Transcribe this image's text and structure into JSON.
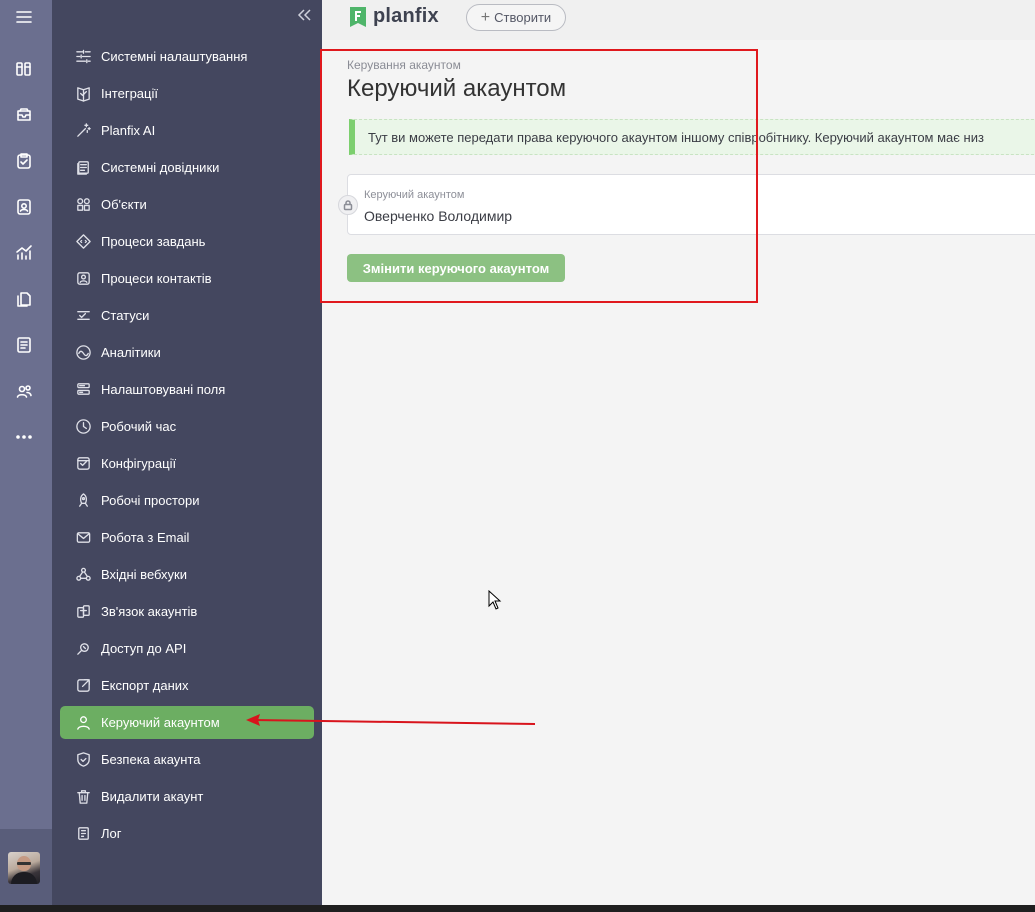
{
  "topbar": {
    "logo_text": "planfix",
    "create_label": "Створити"
  },
  "rail": {
    "icons": [
      "menu-icon",
      "board-icon",
      "inbox-icon",
      "tasks-icon",
      "contacts-icon",
      "analytics-icon",
      "files-icon",
      "docs-icon",
      "users-icon",
      "more-icon"
    ]
  },
  "sidebar": {
    "items": [
      {
        "label": "Системні налаштування",
        "icon": "sliders-icon"
      },
      {
        "label": "Інтеграції",
        "icon": "integrations-icon"
      },
      {
        "label": "Planfix AI",
        "icon": "magic-wand-icon"
      },
      {
        "label": "Системні довідники",
        "icon": "directory-icon"
      },
      {
        "label": "Об'єкти",
        "icon": "objects-icon"
      },
      {
        "label": "Процеси завдань",
        "icon": "process-icon"
      },
      {
        "label": "Процеси контактів",
        "icon": "contact-process-icon"
      },
      {
        "label": "Статуси",
        "icon": "status-icon"
      },
      {
        "label": "Аналітики",
        "icon": "analytics-icon"
      },
      {
        "label": "Налаштовувані поля",
        "icon": "fields-icon"
      },
      {
        "label": "Робочий час",
        "icon": "clock-icon"
      },
      {
        "label": "Конфігурації",
        "icon": "config-icon"
      },
      {
        "label": "Робочі простори",
        "icon": "rocket-icon"
      },
      {
        "label": "Робота з Email",
        "icon": "email-icon"
      },
      {
        "label": "Вхідні вебхуки",
        "icon": "webhook-icon"
      },
      {
        "label": "Зв'язок акаунтів",
        "icon": "link-accounts-icon"
      },
      {
        "label": "Доступ до API",
        "icon": "api-icon"
      },
      {
        "label": "Експорт даних",
        "icon": "export-icon"
      },
      {
        "label": "Керуючий акаунтом",
        "icon": "user-icon",
        "active": true
      },
      {
        "label": "Безпека акаунта",
        "icon": "security-icon"
      },
      {
        "label": "Видалити акаунт",
        "icon": "trash-icon"
      },
      {
        "label": "Лог",
        "icon": "log-icon"
      }
    ]
  },
  "main": {
    "breadcrumb": "Керування акаунтом",
    "title": "Керуючий акаунтом",
    "notice": "Тут ви можете передати права керуючого акаунтом іншому співробітнику. Керуючий акаунтом має низ",
    "field_label": "Керуючий акаунтом",
    "field_value": "Оверченко Володимир",
    "change_button": "Змінити керуючого акаунтом"
  },
  "colors": {
    "sidebar_bg": "#44475f",
    "rail_bg": "#6b6f8f",
    "accent_green": "#6cae62",
    "highlight_red": "#e0191e"
  }
}
